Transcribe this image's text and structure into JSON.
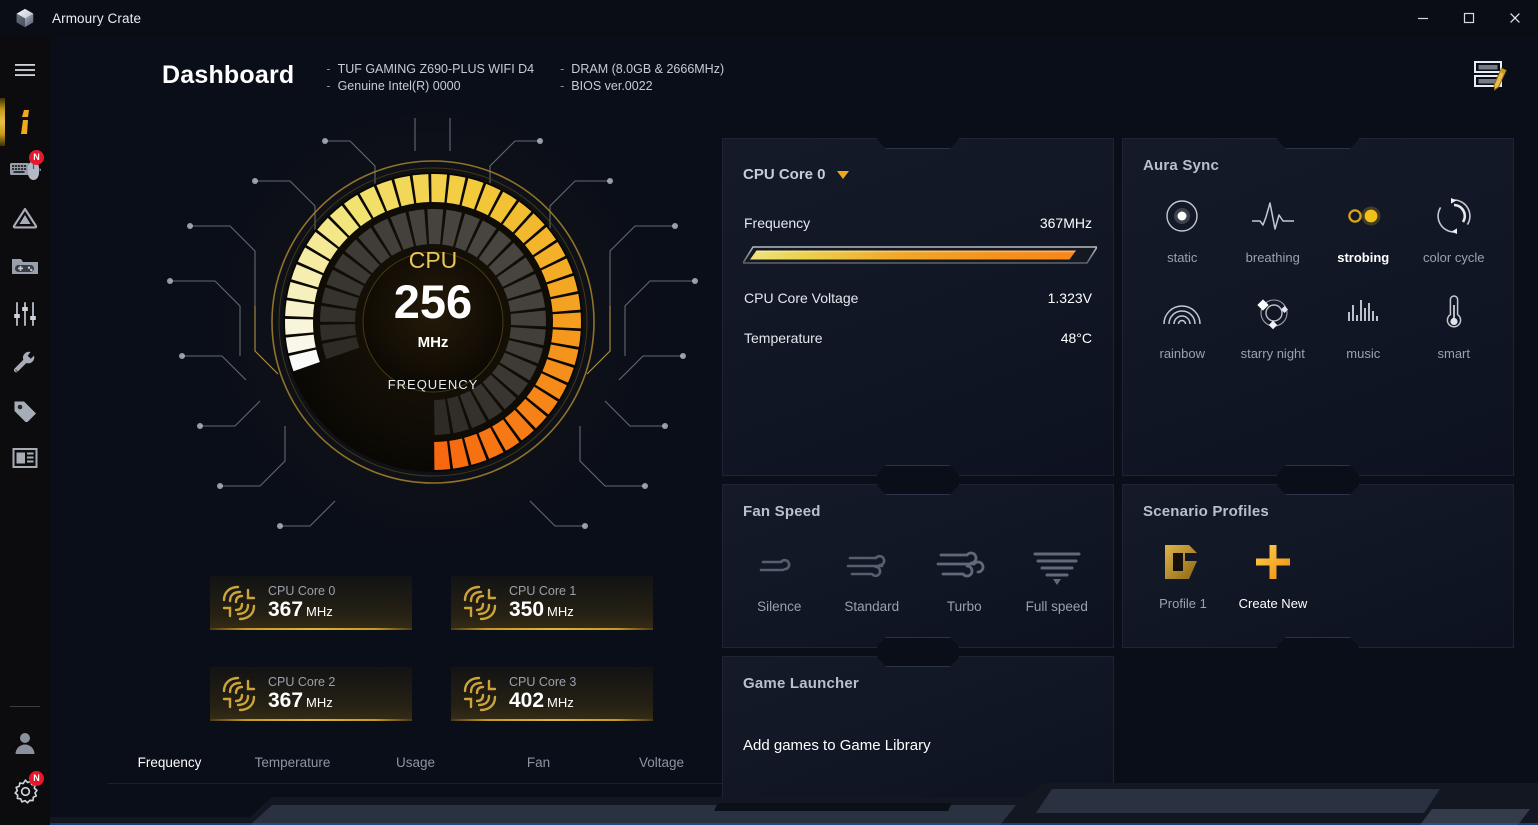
{
  "window": {
    "app_title": "Armoury Crate",
    "logo_icon": "armoury-crate-logo",
    "minimize_label": "—",
    "maximize_label": "□",
    "close_label": "✕"
  },
  "colors": {
    "accent_gold": "#e8b53d",
    "accent_orange": "#f0851d",
    "badge_red": "#e8172b",
    "panel_bg": "#121826",
    "page_bg": "#0a0e18",
    "sidebar_bg": "#0c0c0e"
  },
  "sidebar": {
    "hamburger_icon": "hamburger-menu-icon",
    "items": [
      {
        "name": "dashboard",
        "icon": "info-i-icon",
        "active": true,
        "badge": ""
      },
      {
        "name": "device-settings",
        "icon": "keyboard-mouse-icon",
        "active": false,
        "badge": "N"
      },
      {
        "name": "aura-sync",
        "icon": "aura-triangle-icon",
        "active": false,
        "badge": ""
      },
      {
        "name": "game-library",
        "icon": "gamepad-folder-icon",
        "active": false,
        "badge": ""
      },
      {
        "name": "scenario-profiles",
        "icon": "sliders-icon",
        "active": false,
        "badge": ""
      },
      {
        "name": "tools",
        "icon": "wrench-icon",
        "active": false,
        "badge": ""
      },
      {
        "name": "featured",
        "icon": "tag-icon",
        "active": false,
        "badge": ""
      },
      {
        "name": "news",
        "icon": "news-panel-icon",
        "active": false,
        "badge": ""
      }
    ],
    "bottom_items": [
      {
        "name": "user-account",
        "icon": "user-avatar-icon",
        "badge": ""
      },
      {
        "name": "settings",
        "icon": "gear-icon",
        "badge": "N"
      }
    ]
  },
  "header": {
    "title": "Dashboard",
    "sysinfo": [
      [
        "TUF GAMING Z690-PLUS WIFI D4",
        "Genuine Intel(R) 0000"
      ],
      [
        "DRAM (8.0GB & 2666MHz)",
        "BIOS ver.0022"
      ]
    ],
    "dash": "-",
    "edit_layout_icon": "edit-layout-pencil-icon"
  },
  "gauge": {
    "top_label": "CPU",
    "value": "256",
    "unit": "MHz",
    "caption": "FREQUENCY",
    "percent": 68
  },
  "cores": [
    {
      "label": "CPU Core 0",
      "value": "367",
      "unit": "MHz",
      "icon": "circuit-trace-icon"
    },
    {
      "label": "CPU Core 1",
      "value": "350",
      "unit": "MHz",
      "icon": "circuit-trace-icon"
    },
    {
      "label": "CPU Core 2",
      "value": "367",
      "unit": "MHz",
      "icon": "circuit-trace-icon"
    },
    {
      "label": "CPU Core 3",
      "value": "402",
      "unit": "MHz",
      "icon": "circuit-trace-icon"
    }
  ],
  "tabs": [
    {
      "label": "Frequency",
      "active": true
    },
    {
      "label": "Temperature",
      "active": false
    },
    {
      "label": "Usage",
      "active": false
    },
    {
      "label": "Fan",
      "active": false
    },
    {
      "label": "Voltage",
      "active": false
    }
  ],
  "cpu_panel": {
    "selector_label": "CPU Core 0",
    "caret_icon": "chevron-down-icon",
    "metrics": [
      {
        "name": "Frequency",
        "value": "367MHz"
      },
      {
        "name": "CPU Core Voltage",
        "value": "1.323V"
      },
      {
        "name": "Temperature",
        "value": "48°C"
      }
    ],
    "progress_percent": 93
  },
  "aura": {
    "title": "Aura Sync",
    "effects": [
      {
        "label": "static",
        "icon": "static-dot-icon",
        "active": false
      },
      {
        "label": "breathing",
        "icon": "waveform-icon",
        "active": false
      },
      {
        "label": "strobing",
        "icon": "two-dots-icon",
        "active": true
      },
      {
        "label": "color cycle",
        "icon": "cycle-arrows-icon",
        "active": false
      },
      {
        "label": "rainbow",
        "icon": "rainbow-arc-icon",
        "active": false
      },
      {
        "label": "starry night",
        "icon": "starry-night-icon",
        "active": false
      },
      {
        "label": "music",
        "icon": "equalizer-bars-icon",
        "active": false
      },
      {
        "label": "smart",
        "icon": "thermometer-icon",
        "active": false
      }
    ]
  },
  "fan": {
    "title": "Fan Speed",
    "modes": [
      {
        "label": "Silence",
        "icon": "wind-small-icon"
      },
      {
        "label": "Standard",
        "icon": "wind-medium-icon"
      },
      {
        "label": "Turbo",
        "icon": "wind-large-icon"
      },
      {
        "label": "Full speed",
        "icon": "wind-full-icon"
      }
    ]
  },
  "scenario": {
    "title": "Scenario Profiles",
    "items": [
      {
        "label": "Profile 1",
        "icon": "profile-d-icon",
        "accent": false
      },
      {
        "label": "Create New",
        "icon": "plus-icon",
        "accent": true
      }
    ]
  },
  "game_launcher": {
    "title": "Game Launcher",
    "message": "Add games to Game Library"
  }
}
